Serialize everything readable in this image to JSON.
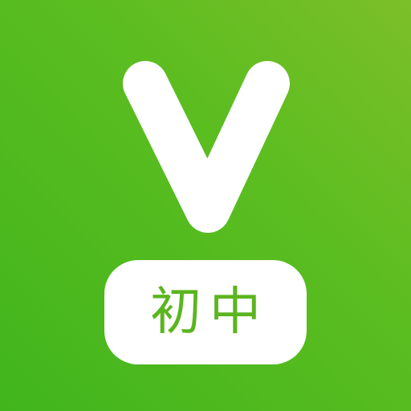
{
  "icon": {
    "logo_icon": "v-letter-icon",
    "badge_text": "初中",
    "colors": {
      "background_light": "#7cbf29",
      "background_dark": "#41b51d",
      "foreground": "#ffffff",
      "badge_text": "#5bb51f"
    }
  }
}
